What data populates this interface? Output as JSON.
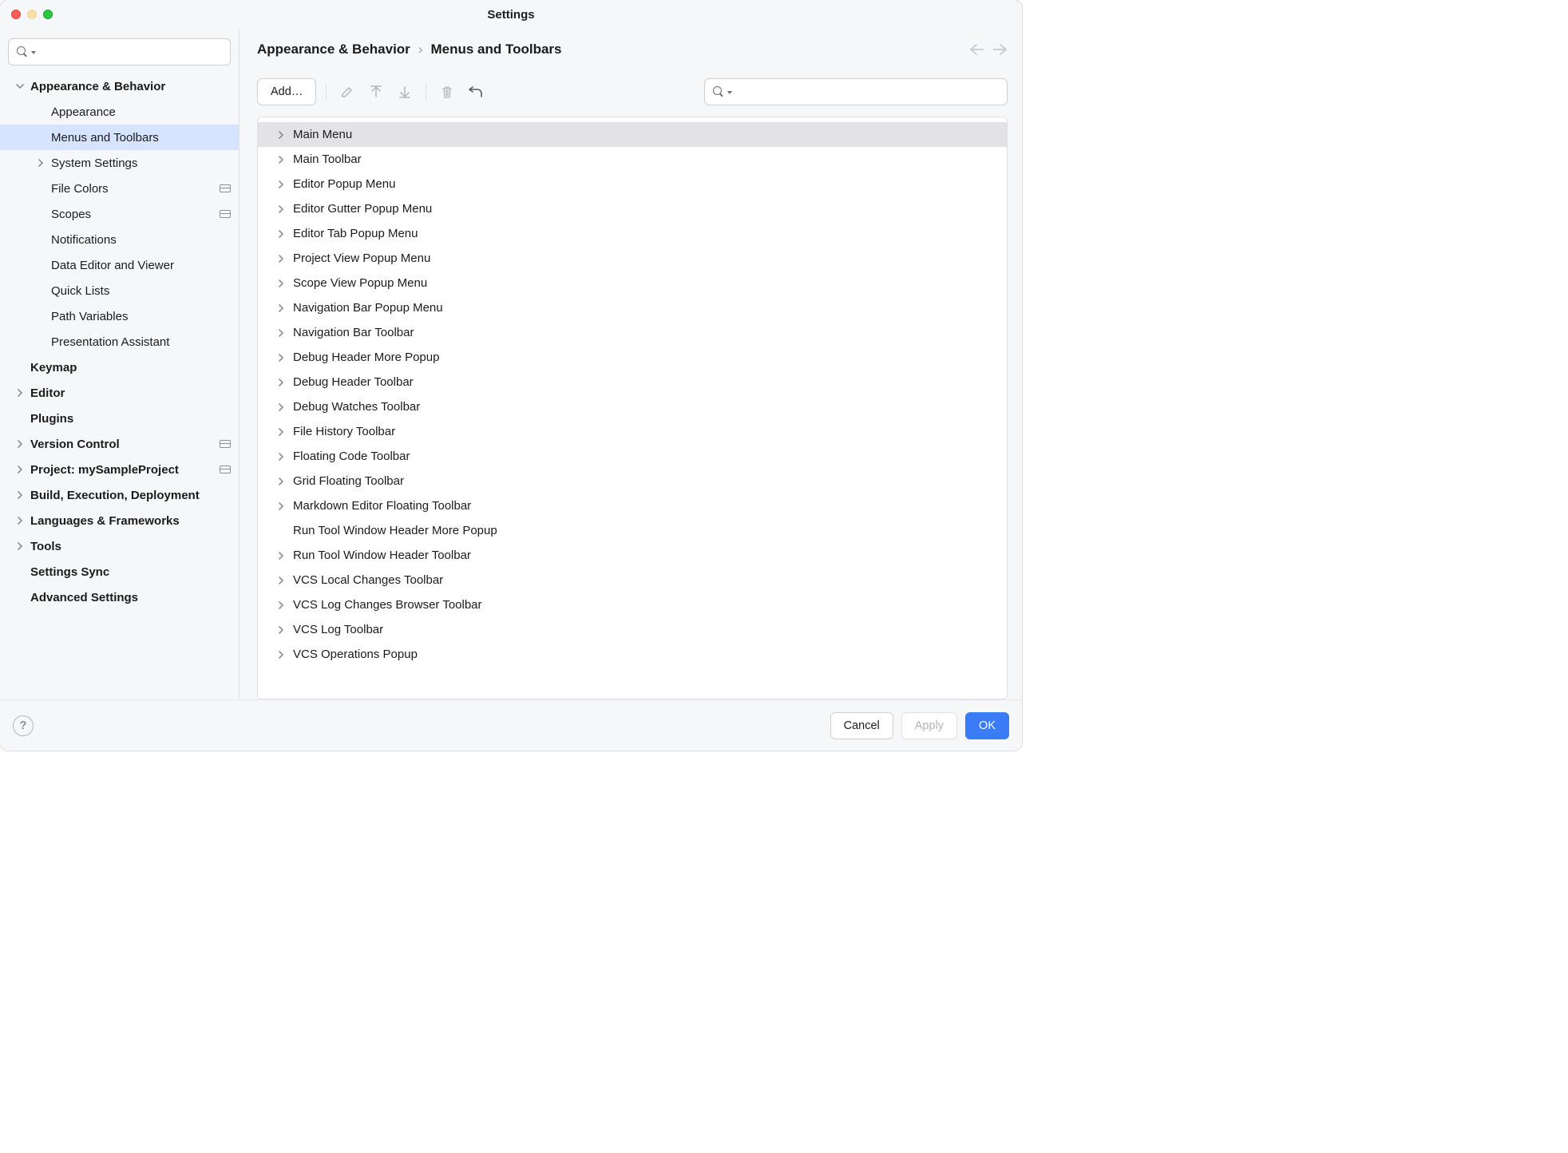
{
  "window": {
    "title": "Settings"
  },
  "sidebar": {
    "search_placeholder": "",
    "items": [
      {
        "label": "Appearance & Behavior",
        "bold": true,
        "depth": 0,
        "arrow": "down",
        "badge": false
      },
      {
        "label": "Appearance",
        "bold": false,
        "depth": 1,
        "arrow": "",
        "badge": false
      },
      {
        "label": "Menus and Toolbars",
        "bold": false,
        "depth": 1,
        "arrow": "",
        "badge": false,
        "selected": true
      },
      {
        "label": "System Settings",
        "bold": false,
        "depth": 1,
        "arrow": "right",
        "badge": false
      },
      {
        "label": "File Colors",
        "bold": false,
        "depth": 1,
        "arrow": "",
        "badge": true
      },
      {
        "label": "Scopes",
        "bold": false,
        "depth": 1,
        "arrow": "",
        "badge": true
      },
      {
        "label": "Notifications",
        "bold": false,
        "depth": 1,
        "arrow": "",
        "badge": false
      },
      {
        "label": "Data Editor and Viewer",
        "bold": false,
        "depth": 1,
        "arrow": "",
        "badge": false
      },
      {
        "label": "Quick Lists",
        "bold": false,
        "depth": 1,
        "arrow": "",
        "badge": false
      },
      {
        "label": "Path Variables",
        "bold": false,
        "depth": 1,
        "arrow": "",
        "badge": false
      },
      {
        "label": "Presentation Assistant",
        "bold": false,
        "depth": 1,
        "arrow": "",
        "badge": false
      },
      {
        "label": "Keymap",
        "bold": true,
        "depth": 0,
        "arrow": "",
        "badge": false
      },
      {
        "label": "Editor",
        "bold": true,
        "depth": 0,
        "arrow": "right",
        "badge": false
      },
      {
        "label": "Plugins",
        "bold": true,
        "depth": 0,
        "arrow": "",
        "badge": false
      },
      {
        "label": "Version Control",
        "bold": true,
        "depth": 0,
        "arrow": "right",
        "badge": true
      },
      {
        "label": "Project: mySampleProject",
        "bold": true,
        "depth": 0,
        "arrow": "right",
        "badge": true
      },
      {
        "label": "Build, Execution, Deployment",
        "bold": true,
        "depth": 0,
        "arrow": "right",
        "badge": false
      },
      {
        "label": "Languages & Frameworks",
        "bold": true,
        "depth": 0,
        "arrow": "right",
        "badge": false
      },
      {
        "label": "Tools",
        "bold": true,
        "depth": 0,
        "arrow": "right",
        "badge": false
      },
      {
        "label": "Settings Sync",
        "bold": true,
        "depth": 0,
        "arrow": "",
        "badge": false
      },
      {
        "label": "Advanced Settings",
        "bold": true,
        "depth": 0,
        "arrow": "",
        "badge": false
      }
    ]
  },
  "breadcrumb": {
    "root": "Appearance & Behavior",
    "leaf": "Menus and Toolbars",
    "sep": "›"
  },
  "toolbar": {
    "add_label": "Add…",
    "search_placeholder": ""
  },
  "menu_tree": [
    {
      "label": "Main Menu",
      "arrow": "right",
      "selected": true
    },
    {
      "label": "Main Toolbar",
      "arrow": "right"
    },
    {
      "label": "Editor Popup Menu",
      "arrow": "right"
    },
    {
      "label": "Editor Gutter Popup Menu",
      "arrow": "right"
    },
    {
      "label": "Editor Tab Popup Menu",
      "arrow": "right"
    },
    {
      "label": "Project View Popup Menu",
      "arrow": "right"
    },
    {
      "label": "Scope View Popup Menu",
      "arrow": "right"
    },
    {
      "label": "Navigation Bar Popup Menu",
      "arrow": "right"
    },
    {
      "label": "Navigation Bar Toolbar",
      "arrow": "right"
    },
    {
      "label": "Debug Header More Popup",
      "arrow": "right"
    },
    {
      "label": "Debug Header Toolbar",
      "arrow": "right"
    },
    {
      "label": "Debug Watches Toolbar",
      "arrow": "right"
    },
    {
      "label": "File History Toolbar",
      "arrow": "right"
    },
    {
      "label": "Floating Code Toolbar",
      "arrow": "right"
    },
    {
      "label": "Grid Floating Toolbar",
      "arrow": "right"
    },
    {
      "label": "Markdown Editor Floating Toolbar",
      "arrow": "right"
    },
    {
      "label": "Run Tool Window Header More Popup",
      "arrow": ""
    },
    {
      "label": "Run Tool Window Header Toolbar",
      "arrow": "right"
    },
    {
      "label": "VCS Local Changes Toolbar",
      "arrow": "right"
    },
    {
      "label": "VCS Log Changes Browser Toolbar",
      "arrow": "right"
    },
    {
      "label": "VCS Log Toolbar",
      "arrow": "right"
    },
    {
      "label": "VCS Operations Popup",
      "arrow": "right"
    }
  ],
  "footer": {
    "cancel": "Cancel",
    "apply": "Apply",
    "ok": "OK",
    "help": "?"
  }
}
